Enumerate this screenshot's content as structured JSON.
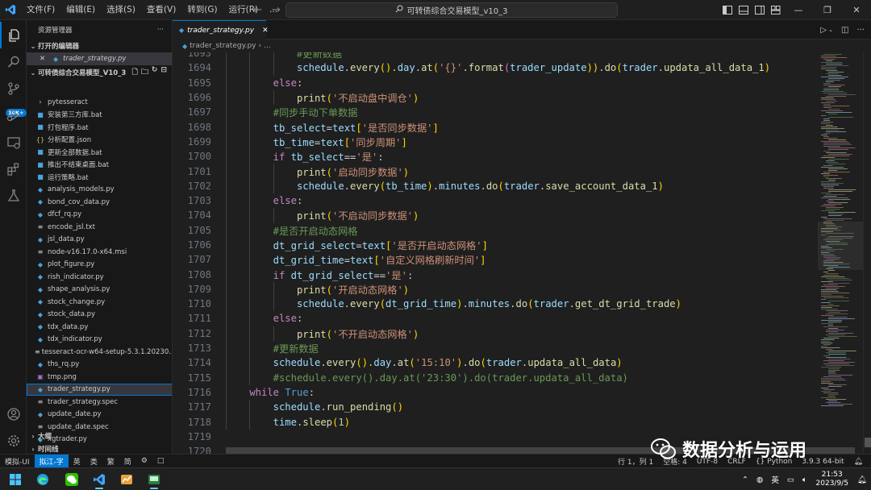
{
  "menu": [
    "文件(F)",
    "编辑(E)",
    "选择(S)",
    "查看(V)",
    "转到(G)",
    "运行(R)",
    "..."
  ],
  "command_center": "可转债综合交易模型_v10_3",
  "activity": {
    "badge": "10K+"
  },
  "sidebar": {
    "title": "资源管理器",
    "more": "···",
    "open_editors_label": "打开的编辑器",
    "open_editor_file": "trader_strategy.py",
    "project_label": "可转债综合交易模型_V10_3",
    "files": [
      {
        "name": "pytesseract",
        "type": "folder"
      },
      {
        "name": "安装第三方库.bat",
        "type": "bat"
      },
      {
        "name": "打包程序.bat",
        "type": "bat"
      },
      {
        "name": "分析配置.json",
        "type": "json"
      },
      {
        "name": "更新全部数据.bat",
        "type": "bat"
      },
      {
        "name": "推出不结束桌面.bat",
        "type": "bat"
      },
      {
        "name": "运行策略.bat",
        "type": "bat"
      },
      {
        "name": "analysis_models.py",
        "type": "py"
      },
      {
        "name": "bond_cov_data.py",
        "type": "py"
      },
      {
        "name": "dfcf_rq.py",
        "type": "py"
      },
      {
        "name": "encode_jsl.txt",
        "type": "txt"
      },
      {
        "name": "jsl_data.py",
        "type": "py"
      },
      {
        "name": "node-v16.17.0-x64.msi",
        "type": "txt"
      },
      {
        "name": "plot_figure.py",
        "type": "py"
      },
      {
        "name": "rish_indicator.py",
        "type": "py"
      },
      {
        "name": "shape_analysis.py",
        "type": "py"
      },
      {
        "name": "stock_change.py",
        "type": "py"
      },
      {
        "name": "stock_data.py",
        "type": "py"
      },
      {
        "name": "tdx_data.py",
        "type": "py"
      },
      {
        "name": "tdx_indicator.py",
        "type": "py"
      },
      {
        "name": "tesseract-ocr-w64-setup-5.3.1.20230...",
        "type": "txt"
      },
      {
        "name": "ths_rq.py",
        "type": "py"
      },
      {
        "name": "tmp.png",
        "type": "png"
      },
      {
        "name": "trader_strategy.py",
        "type": "py",
        "selected": true
      },
      {
        "name": "trader_strategy.spec",
        "type": "txt"
      },
      {
        "name": "update_date.py",
        "type": "py"
      },
      {
        "name": "update_date.spec",
        "type": "txt"
      },
      {
        "name": "xgtrader.py",
        "type": "py"
      }
    ],
    "outline_label": "大纲",
    "timeline_label": "时间线"
  },
  "editor": {
    "tab_label": "trader_strategy.py",
    "breadcrumb_file": "trader_strategy.py",
    "breadcrumb_more": "...",
    "lines": [
      {
        "n": "1693",
        "indent": 3,
        "tokens": [
          [
            "#更新数据",
            "#6a9955"
          ]
        ]
      },
      {
        "n": "1694",
        "indent": 3,
        "tokens": [
          [
            "schedule",
            "#9cdcfe"
          ],
          [
            ".",
            "#cccccc"
          ],
          [
            "every",
            "#dcdcaa"
          ],
          [
            "().",
            "#ffd700"
          ],
          [
            "day",
            "#9cdcfe"
          ],
          [
            ".",
            "#cccccc"
          ],
          [
            "at",
            "#dcdcaa"
          ],
          [
            "(",
            "#ffd700"
          ],
          [
            "'{}'",
            "#ce9178"
          ],
          [
            ".",
            "#cccccc"
          ],
          [
            "format",
            "#dcdcaa"
          ],
          [
            "(",
            "#da70d6"
          ],
          [
            "trader_update",
            "#9cdcfe"
          ],
          [
            "))",
            "#ffd700"
          ],
          [
            ".",
            "#cccccc"
          ],
          [
            "do",
            "#dcdcaa"
          ],
          [
            "(",
            "#ffd700"
          ],
          [
            "trader",
            "#9cdcfe"
          ],
          [
            ".",
            "#cccccc"
          ],
          [
            "updata_all_data_1",
            "#dcdcaa"
          ],
          [
            ")",
            "#ffd700"
          ]
        ]
      },
      {
        "n": "1695",
        "indent": 2,
        "tokens": [
          [
            "else",
            "#c586c0"
          ],
          [
            ":",
            "#cccccc"
          ]
        ]
      },
      {
        "n": "1696",
        "indent": 3,
        "tokens": [
          [
            "print",
            "#dcdcaa"
          ],
          [
            "(",
            "#ffd700"
          ],
          [
            "'不启动盘中调仓'",
            "#ce9178"
          ],
          [
            ")",
            "#ffd700"
          ]
        ]
      },
      {
        "n": "1697",
        "indent": 2,
        "tokens": [
          [
            "#同步手动下单数据",
            "#6a9955"
          ]
        ]
      },
      {
        "n": "1698",
        "indent": 2,
        "tokens": [
          [
            "tb_select",
            "#9cdcfe"
          ],
          [
            "=",
            "#d4d4d4"
          ],
          [
            "text",
            "#9cdcfe"
          ],
          [
            "[",
            "#ffd700"
          ],
          [
            "'是否同步数据'",
            "#ce9178"
          ],
          [
            "]",
            "#ffd700"
          ]
        ]
      },
      {
        "n": "1699",
        "indent": 2,
        "tokens": [
          [
            "tb_time",
            "#9cdcfe"
          ],
          [
            "=",
            "#d4d4d4"
          ],
          [
            "text",
            "#9cdcfe"
          ],
          [
            "[",
            "#ffd700"
          ],
          [
            "'同步周期'",
            "#ce9178"
          ],
          [
            "]",
            "#ffd700"
          ]
        ]
      },
      {
        "n": "1700",
        "indent": 2,
        "tokens": [
          [
            "if",
            "#c586c0"
          ],
          [
            " ",
            "#cccccc"
          ],
          [
            "tb_select",
            "#9cdcfe"
          ],
          [
            "==",
            "#d4d4d4"
          ],
          [
            "'是'",
            "#ce9178"
          ],
          [
            ":",
            "#cccccc"
          ]
        ]
      },
      {
        "n": "1701",
        "indent": 3,
        "tokens": [
          [
            "print",
            "#dcdcaa"
          ],
          [
            "(",
            "#ffd700"
          ],
          [
            "'启动同步数据'",
            "#ce9178"
          ],
          [
            ")",
            "#ffd700"
          ]
        ]
      },
      {
        "n": "1702",
        "indent": 3,
        "tokens": [
          [
            "schedule",
            "#9cdcfe"
          ],
          [
            ".",
            "#cccccc"
          ],
          [
            "every",
            "#dcdcaa"
          ],
          [
            "(",
            "#ffd700"
          ],
          [
            "tb_time",
            "#9cdcfe"
          ],
          [
            ")",
            "#ffd700"
          ],
          [
            ".",
            "#cccccc"
          ],
          [
            "minutes",
            "#9cdcfe"
          ],
          [
            ".",
            "#cccccc"
          ],
          [
            "do",
            "#dcdcaa"
          ],
          [
            "(",
            "#ffd700"
          ],
          [
            "trader",
            "#9cdcfe"
          ],
          [
            ".",
            "#cccccc"
          ],
          [
            "save_account_data_1",
            "#dcdcaa"
          ],
          [
            ")",
            "#ffd700"
          ]
        ]
      },
      {
        "n": "1703",
        "indent": 2,
        "tokens": [
          [
            "else",
            "#c586c0"
          ],
          [
            ":",
            "#cccccc"
          ]
        ]
      },
      {
        "n": "1704",
        "indent": 3,
        "tokens": [
          [
            "print",
            "#dcdcaa"
          ],
          [
            "(",
            "#ffd700"
          ],
          [
            "'不启动同步数据'",
            "#ce9178"
          ],
          [
            ")",
            "#ffd700"
          ]
        ]
      },
      {
        "n": "1705",
        "indent": 2,
        "tokens": [
          [
            "#是否开启动态网格",
            "#6a9955"
          ]
        ]
      },
      {
        "n": "1706",
        "indent": 2,
        "tokens": [
          [
            "dt_grid_select",
            "#9cdcfe"
          ],
          [
            "=",
            "#d4d4d4"
          ],
          [
            "text",
            "#9cdcfe"
          ],
          [
            "[",
            "#ffd700"
          ],
          [
            "'是否开启动态网格'",
            "#ce9178"
          ],
          [
            "]",
            "#ffd700"
          ]
        ]
      },
      {
        "n": "1707",
        "indent": 2,
        "tokens": [
          [
            "dt_grid_time",
            "#9cdcfe"
          ],
          [
            "=",
            "#d4d4d4"
          ],
          [
            "text",
            "#9cdcfe"
          ],
          [
            "[",
            "#ffd700"
          ],
          [
            "'自定义网格刷新时间'",
            "#ce9178"
          ],
          [
            "]",
            "#ffd700"
          ]
        ]
      },
      {
        "n": "1708",
        "indent": 2,
        "tokens": [
          [
            "if",
            "#c586c0"
          ],
          [
            " ",
            "#cccccc"
          ],
          [
            "dt_grid_select",
            "#9cdcfe"
          ],
          [
            "==",
            "#d4d4d4"
          ],
          [
            "'是'",
            "#ce9178"
          ],
          [
            ":",
            "#cccccc"
          ]
        ]
      },
      {
        "n": "1709",
        "indent": 3,
        "tokens": [
          [
            "print",
            "#dcdcaa"
          ],
          [
            "(",
            "#ffd700"
          ],
          [
            "'开启动态网格'",
            "#ce9178"
          ],
          [
            ")",
            "#ffd700"
          ]
        ]
      },
      {
        "n": "1710",
        "indent": 3,
        "tokens": [
          [
            "schedule",
            "#9cdcfe"
          ],
          [
            ".",
            "#cccccc"
          ],
          [
            "every",
            "#dcdcaa"
          ],
          [
            "(",
            "#ffd700"
          ],
          [
            "dt_grid_time",
            "#9cdcfe"
          ],
          [
            ")",
            "#ffd700"
          ],
          [
            ".",
            "#cccccc"
          ],
          [
            "minutes",
            "#9cdcfe"
          ],
          [
            ".",
            "#cccccc"
          ],
          [
            "do",
            "#dcdcaa"
          ],
          [
            "(",
            "#ffd700"
          ],
          [
            "trader",
            "#9cdcfe"
          ],
          [
            ".",
            "#cccccc"
          ],
          [
            "get_dt_grid_trade",
            "#dcdcaa"
          ],
          [
            ")",
            "#ffd700"
          ]
        ]
      },
      {
        "n": "1711",
        "indent": 2,
        "tokens": [
          [
            "else",
            "#c586c0"
          ],
          [
            ":",
            "#cccccc"
          ]
        ]
      },
      {
        "n": "1712",
        "indent": 3,
        "tokens": [
          [
            "print",
            "#dcdcaa"
          ],
          [
            "(",
            "#ffd700"
          ],
          [
            "'不开启动态网格'",
            "#ce9178"
          ],
          [
            ")",
            "#ffd700"
          ]
        ]
      },
      {
        "n": "1713",
        "indent": 2,
        "tokens": [
          [
            "#更新数据",
            "#6a9955"
          ]
        ]
      },
      {
        "n": "1714",
        "indent": 2,
        "tokens": [
          [
            "schedule",
            "#9cdcfe"
          ],
          [
            ".",
            "#cccccc"
          ],
          [
            "every",
            "#dcdcaa"
          ],
          [
            "().",
            "#ffd700"
          ],
          [
            "day",
            "#9cdcfe"
          ],
          [
            ".",
            "#cccccc"
          ],
          [
            "at",
            "#dcdcaa"
          ],
          [
            "(",
            "#ffd700"
          ],
          [
            "'15:10'",
            "#ce9178"
          ],
          [
            ")",
            "#ffd700"
          ],
          [
            ".",
            "#cccccc"
          ],
          [
            "do",
            "#dcdcaa"
          ],
          [
            "(",
            "#ffd700"
          ],
          [
            "trader",
            "#9cdcfe"
          ],
          [
            ".",
            "#cccccc"
          ],
          [
            "updata_all_data",
            "#dcdcaa"
          ],
          [
            ")",
            "#ffd700"
          ]
        ]
      },
      {
        "n": "1715",
        "indent": 2,
        "tokens": [
          [
            "#schedule.every().day.at('23:30').do(trader.updata_all_data)",
            "#6a9955"
          ]
        ]
      },
      {
        "n": "1716",
        "indent": 1,
        "tokens": [
          [
            "while",
            "#c586c0"
          ],
          [
            " ",
            "#cccccc"
          ],
          [
            "True",
            "#569cd6"
          ],
          [
            ":",
            "#cccccc"
          ]
        ]
      },
      {
        "n": "1717",
        "indent": 2,
        "tokens": [
          [
            "schedule",
            "#9cdcfe"
          ],
          [
            ".",
            "#cccccc"
          ],
          [
            "run_pending",
            "#dcdcaa"
          ],
          [
            "()",
            "#ffd700"
          ]
        ]
      },
      {
        "n": "1718",
        "indent": 2,
        "tokens": [
          [
            "time",
            "#9cdcfe"
          ],
          [
            ".",
            "#cccccc"
          ],
          [
            "sleep",
            "#dcdcaa"
          ],
          [
            "(",
            "#ffd700"
          ],
          [
            "1",
            "#b5cea8"
          ],
          [
            ")",
            "#ffd700"
          ]
        ]
      },
      {
        "n": "1719",
        "indent": 0,
        "tokens": []
      },
      {
        "n": "1720",
        "indent": 0,
        "tokens": []
      }
    ]
  },
  "statusbar": {
    "remote": "模拟-UI",
    "ime": "拟江-字",
    "ime_items": [
      "英",
      "类",
      "繁",
      "简",
      "⚙",
      "□"
    ],
    "position": "行 1，列 1",
    "spaces": "空格: 4",
    "encoding": "UTF-8",
    "eol": "CRLF",
    "language": "Python",
    "version": "3.9.3 64-bit"
  },
  "taskbar": {
    "tray_lang": "英",
    "time": "21:53",
    "date": "2023/9/5"
  },
  "watermark": "数据分析与运用",
  "colors": {
    "accent": "#0078d4",
    "editor_bg": "#1f1f1f",
    "sidebar_bg": "#181818"
  }
}
